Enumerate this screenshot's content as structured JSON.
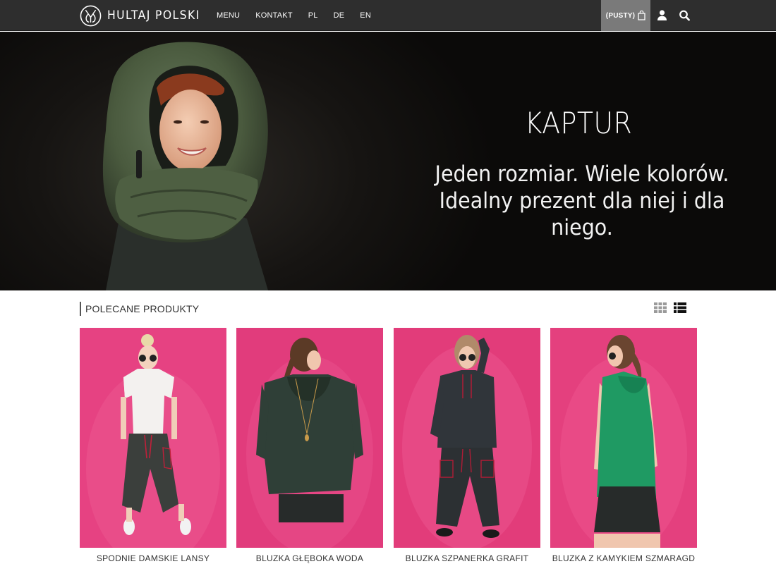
{
  "colors": {
    "topbar": "#2e2e2e",
    "cart_bg": "#7a7a7a",
    "hero_bg": "#0b0a09",
    "product_bg": "#e23c7a",
    "scarf": "#4a5a3e"
  },
  "header": {
    "brand": "HULTAJ POLSKI",
    "logo_icon": "hp-monogram-logo",
    "nav": [
      "MENU",
      "KONTAKT",
      "PL",
      "DE",
      "EN"
    ],
    "cart_label": "(PUSTY)",
    "cart_icon": "shopping-bag-icon",
    "user_icon": "user-icon",
    "search_icon": "search-icon"
  },
  "hero": {
    "title": "KAPTUR",
    "subtitle_line1": "Jeden rozmiar. Wiele kolorów.",
    "subtitle_line2": "Idealny prezent dla niej i dla niego."
  },
  "featured": {
    "title": "POLECANE PRODUKTY",
    "view_icons": [
      "grid-view-icon",
      "list-view-icon"
    ],
    "products": [
      {
        "name": "SPODNIE DAMSKIE LANSY"
      },
      {
        "name": "BLUZKA GŁĘBOKA WODA"
      },
      {
        "name": "BLUZKA SZPANERKA GRAFIT"
      },
      {
        "name": "BLUZKA Z KAMYKIEM SZMARAGD"
      }
    ]
  }
}
